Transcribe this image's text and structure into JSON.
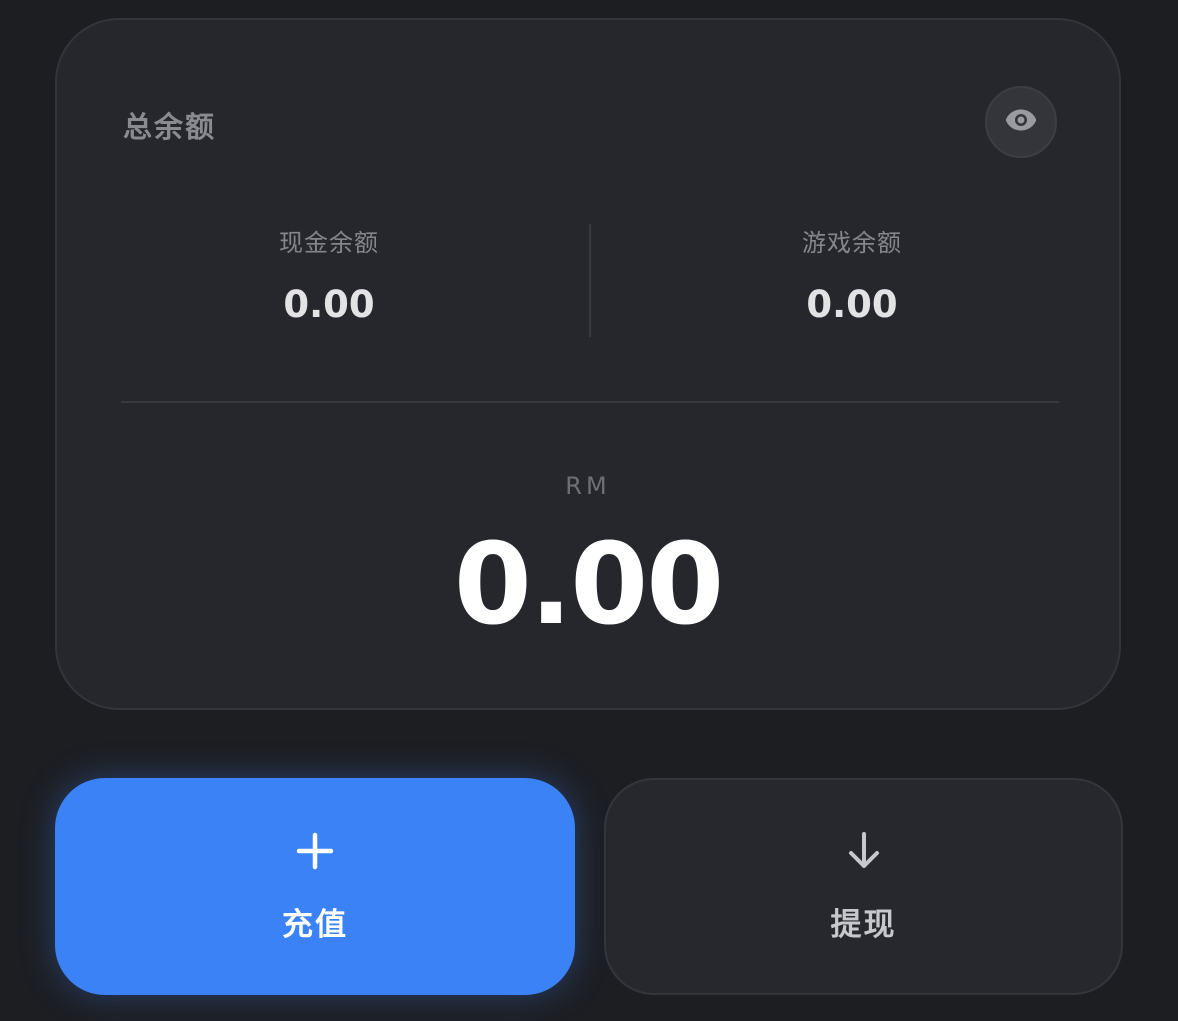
{
  "card": {
    "title": "总余额",
    "cash": {
      "label": "现金余额",
      "value": "0.00"
    },
    "game": {
      "label": "游戏余额",
      "value": "0.00"
    },
    "currency": "RM",
    "total": "0.00",
    "visibility_icon": "eye-icon"
  },
  "actions": {
    "deposit": {
      "label": "充值",
      "icon": "plus-icon",
      "color": "#3b82f6"
    },
    "withdraw": {
      "label": "提现",
      "icon": "arrow-down-icon"
    }
  },
  "colors": {
    "background": "#1d1e22",
    "card": "#26272c",
    "accent": "#3b82f6"
  }
}
